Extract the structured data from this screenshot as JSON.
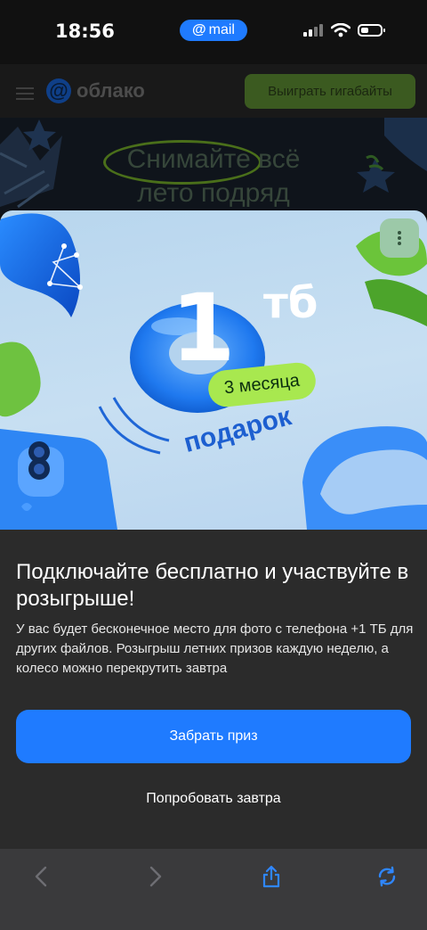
{
  "status_bar": {
    "time": "18:56",
    "pill_label": "mail",
    "pill_symbol": "@"
  },
  "site": {
    "logo_symbol": "@",
    "logo_text": "облако",
    "cta_button": "Выиграть гигабайты",
    "hero_line1": "Снимайте всё",
    "hero_line2": "лето подряд"
  },
  "banner": {
    "big_number": "1",
    "unit": "тб",
    "duration_badge": "3 месяца",
    "gift_label": "подарок"
  },
  "promo": {
    "title": "Подключайте бесплатно и участвуйте в розыгрыше!",
    "description": "У вас будет бесконечное место для фото с телефона +1 ТБ для других файлов. Розыгрыш летних призов каждую неделю, а колесо можно перекрутить завтра",
    "primary_button": "Забрать приз",
    "secondary_button": "Попробовать завтра"
  },
  "colors": {
    "accent_blue": "#1f7bff",
    "accent_green": "#a8e84f",
    "sheet_bg": "#2b2b2b"
  },
  "icons": [
    "more-vertical-icon",
    "back-arrow-icon",
    "forward-arrow-icon",
    "share-icon",
    "refresh-icon"
  ]
}
